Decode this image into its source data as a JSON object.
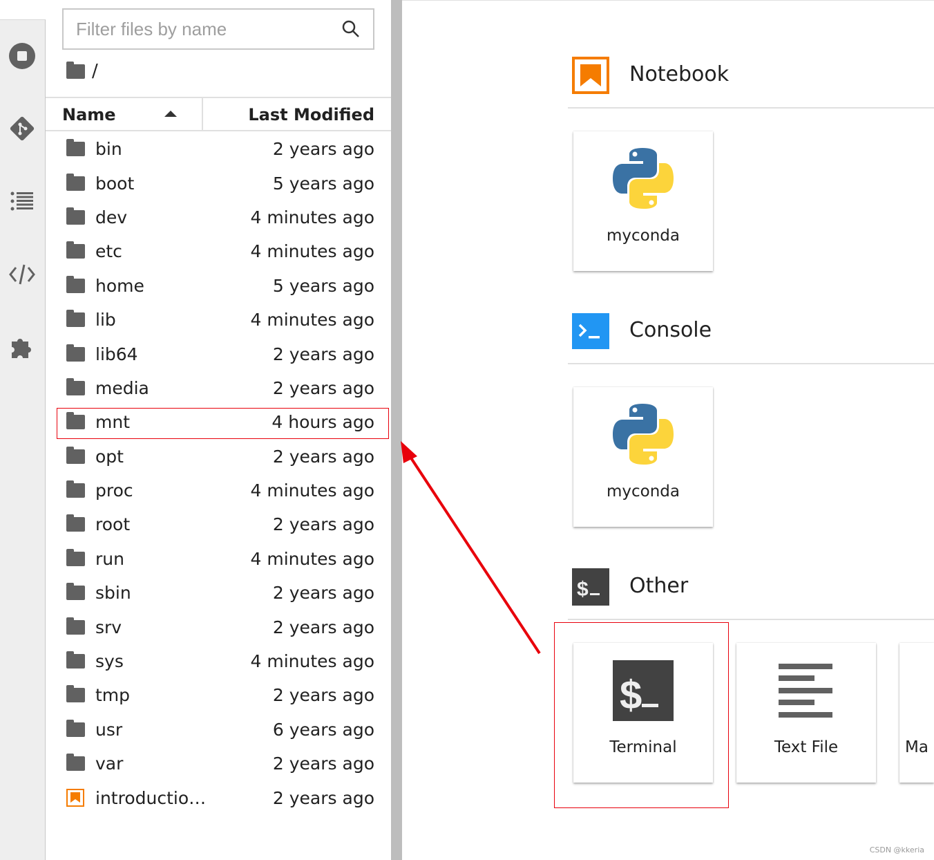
{
  "activity_bar": {
    "icons": [
      "running-stop-icon",
      "git-icon",
      "table-of-contents-icon",
      "code-icon",
      "extension-puzzle-icon"
    ]
  },
  "file_browser": {
    "filter_placeholder": "Filter files by name",
    "breadcrumb": "/",
    "columns": {
      "name": "Name",
      "modified": "Last Modified",
      "sort": "ascending"
    },
    "rows": [
      {
        "name": "bin",
        "modified": "2 years ago",
        "type": "folder"
      },
      {
        "name": "boot",
        "modified": "5 years ago",
        "type": "folder"
      },
      {
        "name": "dev",
        "modified": "4 minutes ago",
        "type": "folder"
      },
      {
        "name": "etc",
        "modified": "4 minutes ago",
        "type": "folder"
      },
      {
        "name": "home",
        "modified": "5 years ago",
        "type": "folder"
      },
      {
        "name": "lib",
        "modified": "4 minutes ago",
        "type": "folder"
      },
      {
        "name": "lib64",
        "modified": "2 years ago",
        "type": "folder"
      },
      {
        "name": "media",
        "modified": "2 years ago",
        "type": "folder"
      },
      {
        "name": "mnt",
        "modified": "4 hours ago",
        "type": "folder",
        "highlighted": true
      },
      {
        "name": "opt",
        "modified": "2 years ago",
        "type": "folder"
      },
      {
        "name": "proc",
        "modified": "4 minutes ago",
        "type": "folder"
      },
      {
        "name": "root",
        "modified": "2 years ago",
        "type": "folder"
      },
      {
        "name": "run",
        "modified": "4 minutes ago",
        "type": "folder"
      },
      {
        "name": "sbin",
        "modified": "2 years ago",
        "type": "folder"
      },
      {
        "name": "srv",
        "modified": "2 years ago",
        "type": "folder"
      },
      {
        "name": "sys",
        "modified": "4 minutes ago",
        "type": "folder"
      },
      {
        "name": "tmp",
        "modified": "2 years ago",
        "type": "folder"
      },
      {
        "name": "usr",
        "modified": "6 years ago",
        "type": "folder"
      },
      {
        "name": "var",
        "modified": "2 years ago",
        "type": "folder"
      },
      {
        "name": "introductio…",
        "modified": "2 years ago",
        "type": "notebook"
      }
    ]
  },
  "launcher": {
    "notebook": {
      "title": "Notebook",
      "cards": [
        {
          "label": "myconda"
        }
      ]
    },
    "console": {
      "title": "Console",
      "cards": [
        {
          "label": "myconda"
        }
      ]
    },
    "other": {
      "title": "Other",
      "cards": [
        {
          "label": "Terminal",
          "highlighted": true
        },
        {
          "label": "Text File"
        },
        {
          "label": "Ma"
        }
      ]
    }
  },
  "colors": {
    "annotation": "#e8000b",
    "notebook_orange": "#f57c00",
    "console_blue": "#2196f3",
    "terminal_dark": "#424242"
  },
  "watermark": "CSDN @kkeria"
}
